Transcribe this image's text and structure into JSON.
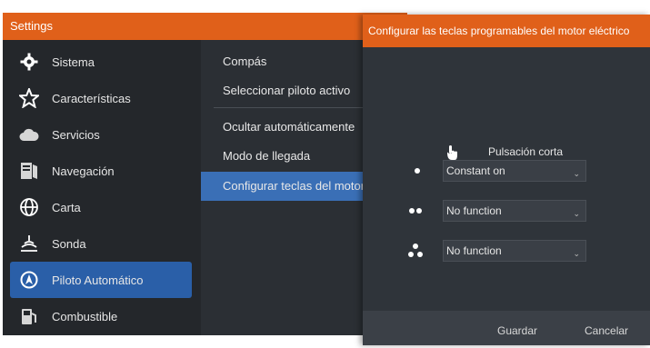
{
  "settings": {
    "title": "Settings",
    "menu": [
      {
        "label": "Sistema",
        "icon": "gear-icon"
      },
      {
        "label": "Características",
        "icon": "star-icon"
      },
      {
        "label": "Servicios",
        "icon": "cloud-icon"
      },
      {
        "label": "Navegación",
        "icon": "navigation-icon"
      },
      {
        "label": "Carta",
        "icon": "globe-icon"
      },
      {
        "label": "Sonda",
        "icon": "sonar-icon"
      },
      {
        "label": "Piloto Automático",
        "icon": "autopilot-icon",
        "selected": true
      },
      {
        "label": "Combustible",
        "icon": "fuel-pump-icon"
      }
    ],
    "submenu": [
      {
        "label": "Compás"
      },
      {
        "label": "Seleccionar piloto activo"
      },
      {
        "label": "Ocultar automáticamente"
      },
      {
        "label": "Modo de llegada"
      },
      {
        "label": "Configurar teclas del motor",
        "selected": true
      }
    ]
  },
  "dialog": {
    "title": "Configurar las teclas programables del motor eléctrico",
    "column_header": "Pulsación corta",
    "rows": [
      {
        "press": "single-dot-icon",
        "value": "Constant on"
      },
      {
        "press": "double-dot-icon",
        "value": "No function"
      },
      {
        "press": "triple-dot-icon",
        "value": "No function"
      }
    ],
    "save_label": "Guardar",
    "cancel_label": "Cancelar"
  },
  "colors": {
    "accent": "#e0601a",
    "selected": "#2a5fa8"
  }
}
